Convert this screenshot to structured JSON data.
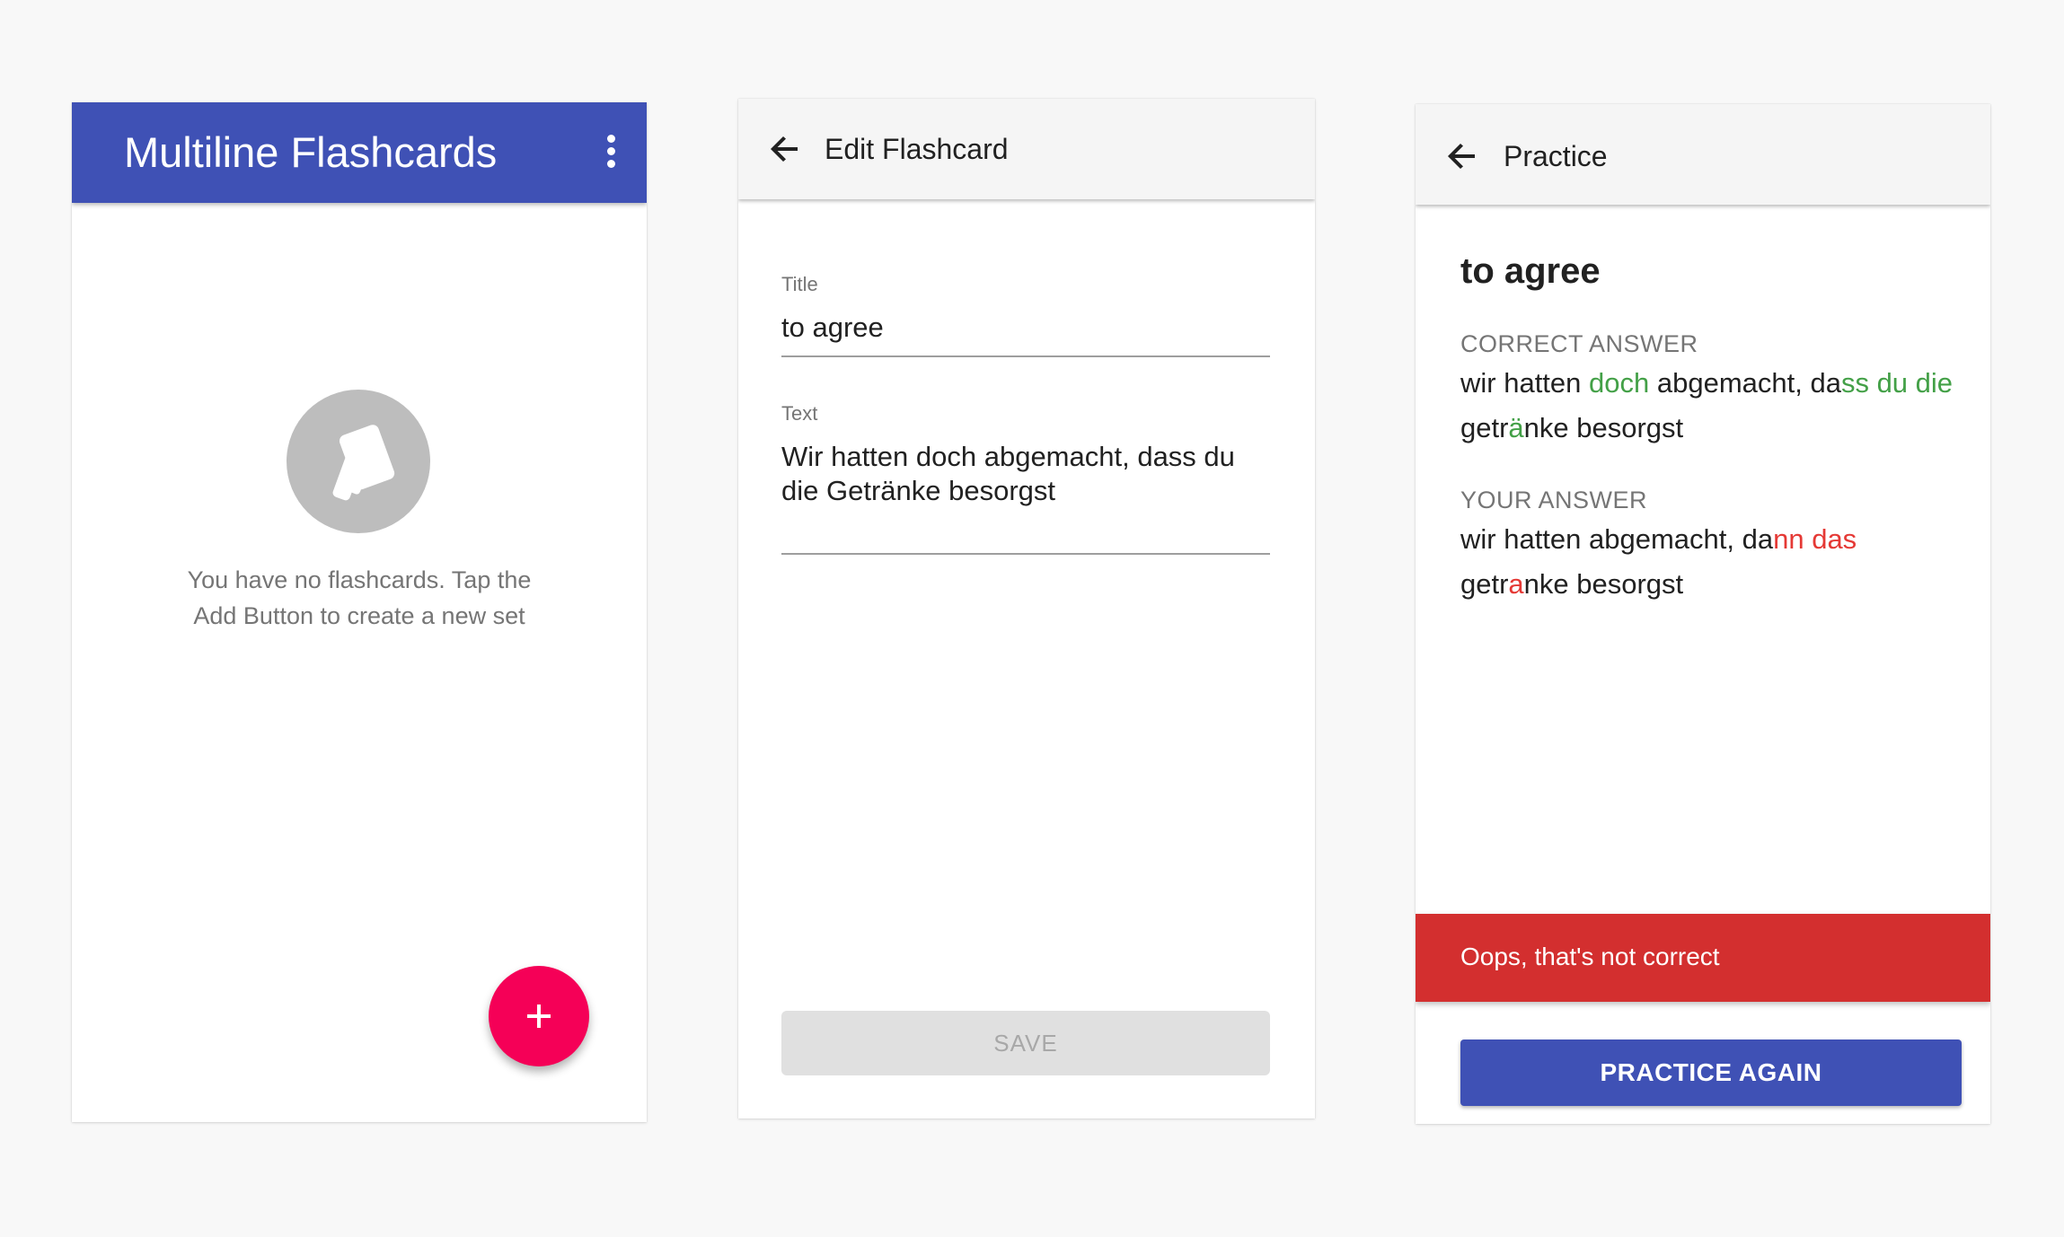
{
  "home": {
    "title": "Multiline Flashcards",
    "menu_icon": "more-vert-icon",
    "empty_icon": "cards-icon",
    "empty_message": "You have no flashcards. Tap the Add Button to create a new set",
    "fab_icon": "plus-icon"
  },
  "edit": {
    "title": "Edit Flashcard",
    "back_icon": "arrow-back-icon",
    "title_field": {
      "label": "Title",
      "value": "to agree"
    },
    "text_field": {
      "label": "Text",
      "value": "Wir hatten doch abgemacht, dass du die Getränke besorgst"
    },
    "save_label": "SAVE"
  },
  "practice": {
    "title": "Practice",
    "back_icon": "arrow-back-icon",
    "card_title": "to agree",
    "correct_label": "CORRECT ANSWER",
    "correct_parts": [
      {
        "text": "wir hatten ",
        "state": "normal"
      },
      {
        "text": "doch",
        "state": "added"
      },
      {
        "text": " abgemacht, da",
        "state": "normal"
      },
      {
        "text": "ss du die",
        "state": "added"
      },
      {
        "text": " getr",
        "state": "normal"
      },
      {
        "text": "ä",
        "state": "added"
      },
      {
        "text": "nke besorgst",
        "state": "normal"
      }
    ],
    "your_label": "YOUR ANSWER",
    "your_parts": [
      {
        "text": "wir hatten abgemacht, da",
        "state": "normal"
      },
      {
        "text": "nn das",
        "state": "removed"
      },
      {
        "text": " getr",
        "state": "normal"
      },
      {
        "text": "a",
        "state": "removed"
      },
      {
        "text": "nke besorgst",
        "state": "normal"
      }
    ],
    "snackbar_text": "Oops, that's not correct",
    "practice_again_label": "PRACTICE AGAIN"
  },
  "colors": {
    "primary": "#3f51b5",
    "accent": "#f50057",
    "error": "#d32f2f",
    "correct": "#43a047",
    "wrong": "#e53935"
  }
}
